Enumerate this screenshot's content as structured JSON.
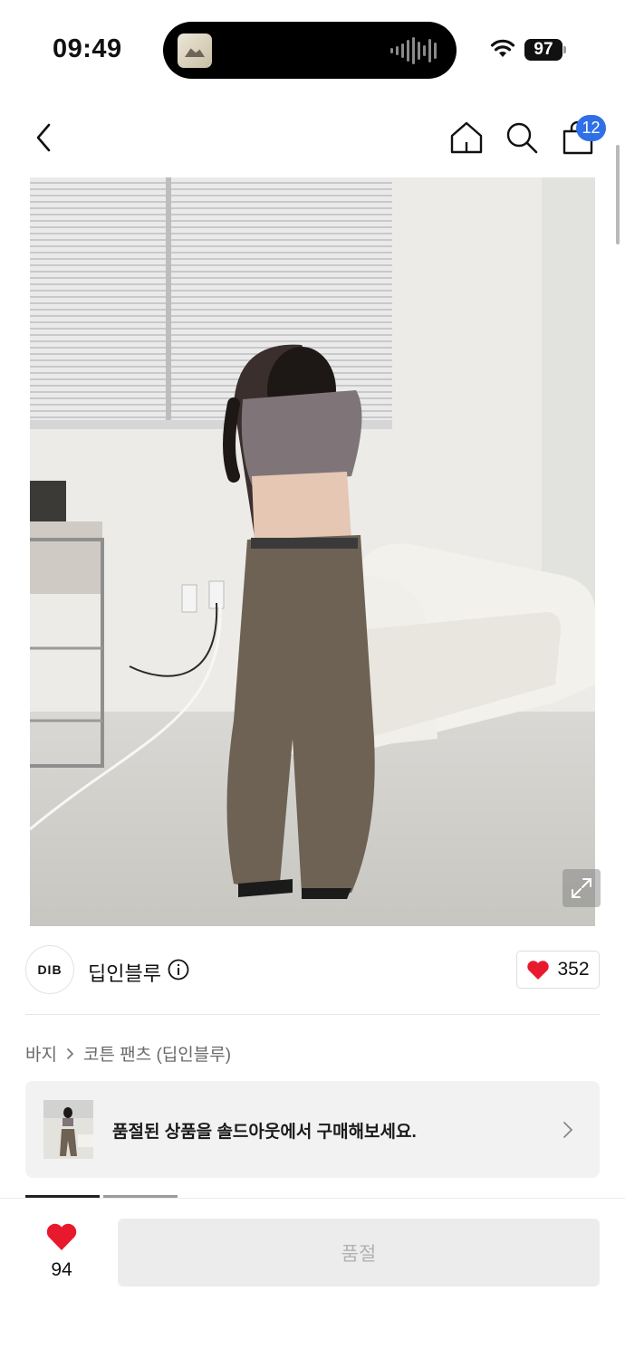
{
  "status_bar": {
    "time": "09:49",
    "battery": "97"
  },
  "nav": {
    "cart_count": "12"
  },
  "brand": {
    "logo_text": "DIB",
    "name": "딥인블루",
    "like_count": "352"
  },
  "breadcrumb": {
    "category": "바지",
    "product": "코튼 팬츠 (딥인블루)"
  },
  "banner": {
    "text": "품절된 상품을 솔드아웃에서 구매해보세요."
  },
  "bottom_bar": {
    "wish_count": "94",
    "buy_label": "품절"
  },
  "colors": {
    "accent_blue": "#2f6fe8",
    "heart_red": "#e8192c",
    "disabled_bg": "#ececec",
    "disabled_text": "#b2b2b2"
  }
}
